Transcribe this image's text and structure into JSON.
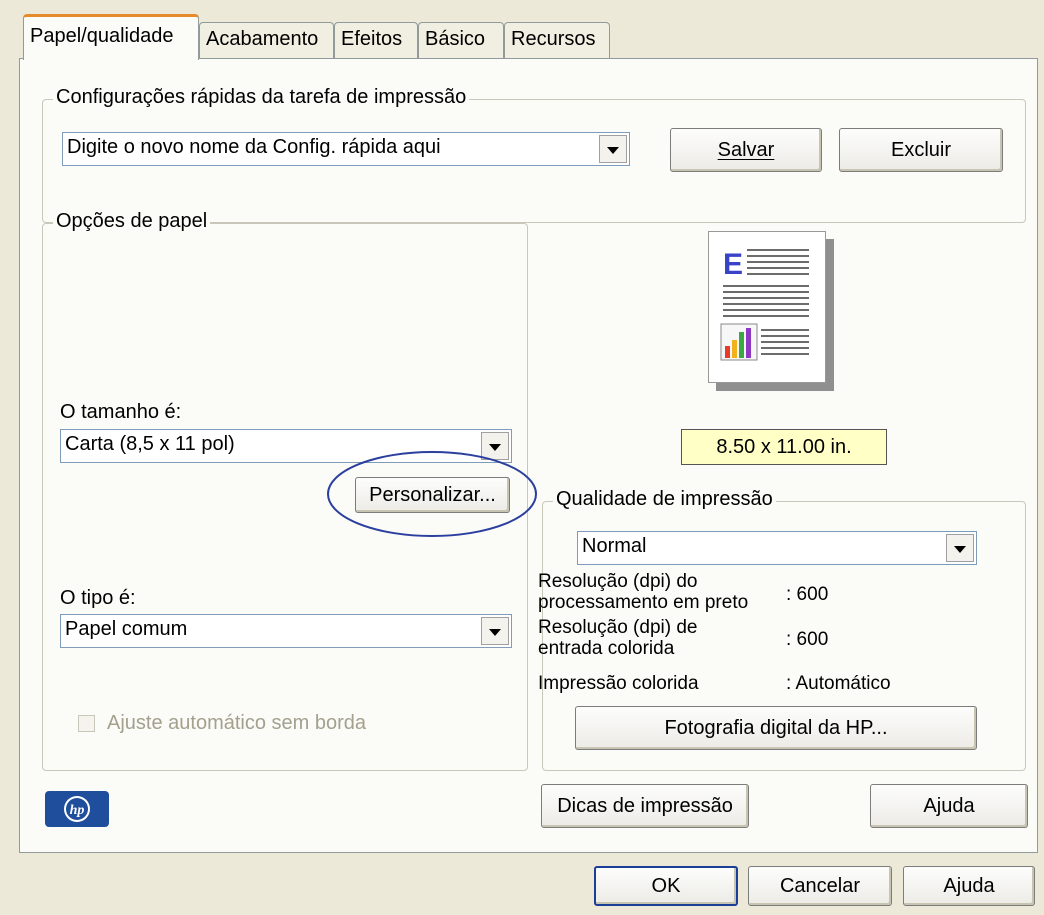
{
  "tabs": [
    {
      "label": "Papel/qualidade"
    },
    {
      "label": "Acabamento"
    },
    {
      "label": "Efeitos"
    },
    {
      "label": "Básico"
    },
    {
      "label": "Recursos"
    }
  ],
  "quick_settings": {
    "title": "Configurações rápidas da tarefa de impressão",
    "combo_value": "Digite o novo nome da Config. rápida aqui",
    "save_label": "Salvar",
    "delete_label": "Excluir"
  },
  "paper_options": {
    "title": "Opções de papel",
    "size_label": "O tamanho é:",
    "size_value": "Carta (8,5 x 11 pol)",
    "customize_label": "Personalizar...",
    "type_label": "O tipo é:",
    "type_value": "Papel comum",
    "borderless_label": "Ajuste automático sem borda"
  },
  "preview": {
    "dimensions": "8.50 x 11.00 in."
  },
  "print_quality": {
    "title": "Qualidade de impressão",
    "value": "Normal",
    "black_res_label": "Resolução (dpi) do processamento em preto",
    "black_res_value": ": 600",
    "color_res_label": "Resolução (dpi) de entrada colorida",
    "color_res_value": ": 600",
    "color_print_label": "Impressão colorida",
    "color_print_value": ": Automático",
    "hp_photo_label": "Fotografia digital da HP..."
  },
  "bottom": {
    "tips_label": "Dicas de impressão",
    "help_label": "Ajuda"
  },
  "dialog": {
    "ok_label": "OK",
    "cancel_label": "Cancelar",
    "help_label": "Ajuda"
  },
  "colors": {
    "active_tab_accent": "#e68b2c",
    "annotation_circle": "#2b3f9e",
    "size_badge": "#ffffc6",
    "hp_logo": "#1f4e9c"
  },
  "icons": [
    "page-preview-icon",
    "hp-logo",
    "dropdown-arrow-icon",
    "checkbox-icon"
  ]
}
